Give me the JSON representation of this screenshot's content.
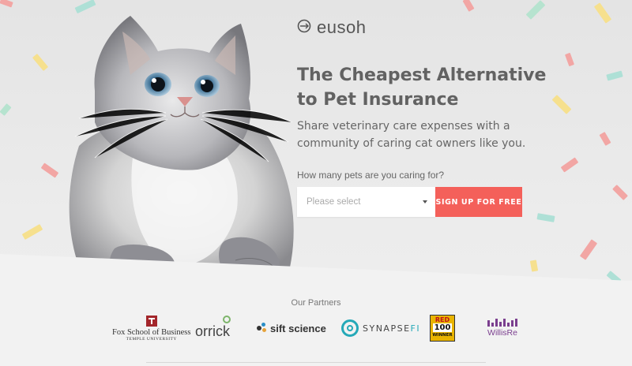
{
  "brand": {
    "name": "eusoh",
    "logo_icon": "swirl-arrows-icon"
  },
  "hero": {
    "headline_line1": "The Cheapest Alternative",
    "headline_line2": "to Pet Insurance",
    "subhead_line1": "Share veterinary care expenses with a",
    "subhead_line2": "community of caring cat owners like you.",
    "question": "How many pets are you caring for?",
    "select_placeholder": "Please select",
    "cta_label": "SIGN UP FOR FREE",
    "image": "fluffy-grey-cat"
  },
  "partners": {
    "title": "Our Partners",
    "items": [
      {
        "name": "Fox School of Business",
        "sub": "TEMPLE UNIVERSITY",
        "icon": "temple-t-icon"
      },
      {
        "name": "orrick",
        "icon": "orrick-circle-icon"
      },
      {
        "name": "sift science",
        "icon": "sift-dots-icon"
      },
      {
        "name": "SYNAPSE",
        "suffix": "FI",
        "icon": "synapse-ring-icon"
      },
      {
        "name": "RED 100 WINNER",
        "badge_top": "RED",
        "badge_num": "100",
        "badge_bottom": "WINNER",
        "icon": "red-herring-badge"
      },
      {
        "name": "WillisRe",
        "icon": "willis-bars-icon"
      }
    ]
  },
  "colors": {
    "accent": "#f4605a",
    "heading": "#626262",
    "text": "#666666",
    "background": "#e8e8e8",
    "footer_bg": "#f2f2f2",
    "synapse": "#25a9b8",
    "willis": "#7b3f8f",
    "fox_red": "#a3262b"
  }
}
